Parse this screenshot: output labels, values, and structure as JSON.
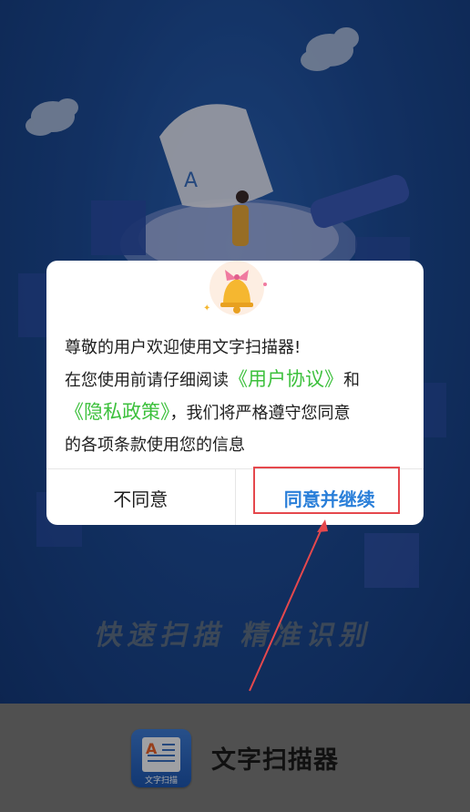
{
  "splash": {
    "slogan": "快速扫描 精准识别"
  },
  "dialog": {
    "line1": "尊敬的用户欢迎使用文字扫描器!",
    "line2_prefix": "在您使用前请仔细阅读",
    "user_agreement_link": "《用户协议》",
    "line2_suffix": "和",
    "privacy_policy_link": "《隐私政策》",
    "line3_suffix": "，我们将严格遵守您同意",
    "line4": "的各项条款使用您的信息",
    "disagree_label": "不同意",
    "agree_label": "同意并继续"
  },
  "footer": {
    "app_name": "文字扫描器",
    "icon_letter": "A",
    "icon_tag": "文字扫描"
  },
  "colors": {
    "link": "#3cc03c",
    "agree": "#2a7fd9",
    "highlight": "#e5484d",
    "splash_bg": "#1d4c98"
  }
}
